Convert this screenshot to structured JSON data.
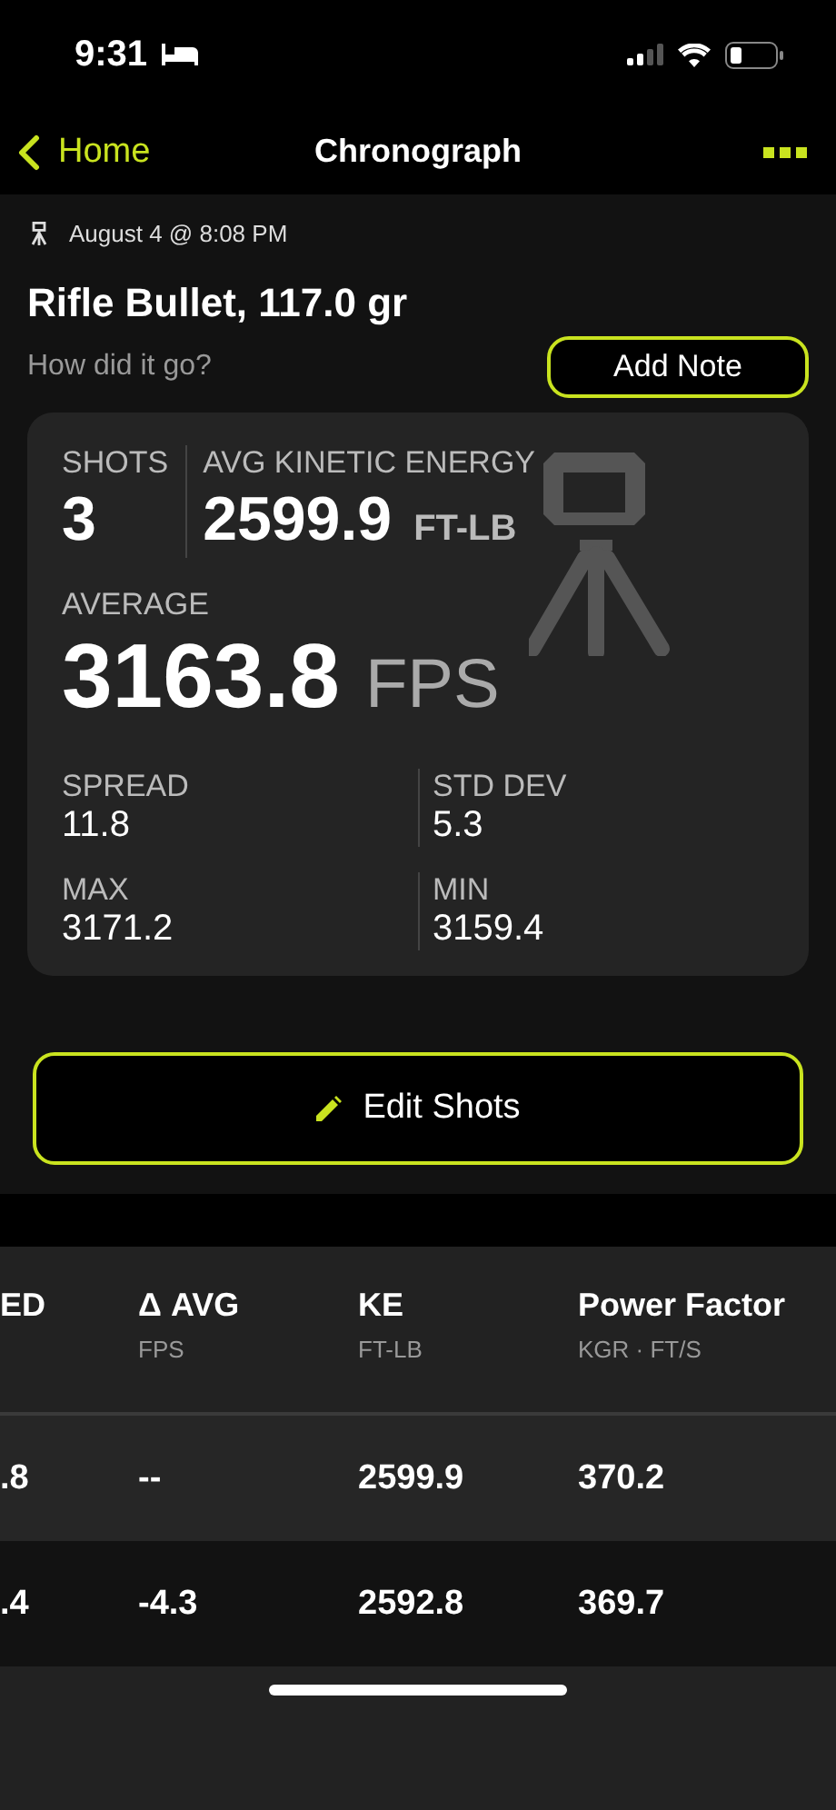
{
  "status_bar": {
    "time": "9:31"
  },
  "nav": {
    "back": "Home",
    "title": "Chronograph"
  },
  "session": {
    "date": "August 4 @ 8:08 PM",
    "title": "Rifle Bullet, 117.0 gr",
    "note_prompt": "How did it go?",
    "note_button": "Add Note"
  },
  "summary": {
    "shots_label": "SHOTS",
    "shots": "3",
    "energy_label": "AVG KINETIC ENERGY",
    "energy": "2599.9",
    "energy_unit": "FT-LB",
    "average_label": "AVERAGE",
    "average": "3163.8",
    "average_unit": "FPS",
    "stats": [
      {
        "label": "SPREAD",
        "value": "11.8"
      },
      {
        "label": "STD DEV",
        "value": "5.3"
      },
      {
        "label": "MAX",
        "value": "3171.2"
      },
      {
        "label": "MIN",
        "value": "3159.4"
      }
    ]
  },
  "edit_button": "Edit Shots",
  "table": {
    "columns": [
      {
        "title": "ED"
      },
      {
        "title": "Δ AVG",
        "unit": "FPS"
      },
      {
        "title": "KE",
        "unit": "FT-LB"
      },
      {
        "title": "Power Factor",
        "unit": "KGR · FT/S"
      }
    ],
    "rows": [
      [
        ".8",
        "--",
        "2599.9",
        "370.2"
      ],
      [
        ".4",
        "-4.3",
        "2592.8",
        "369.7"
      ]
    ]
  }
}
